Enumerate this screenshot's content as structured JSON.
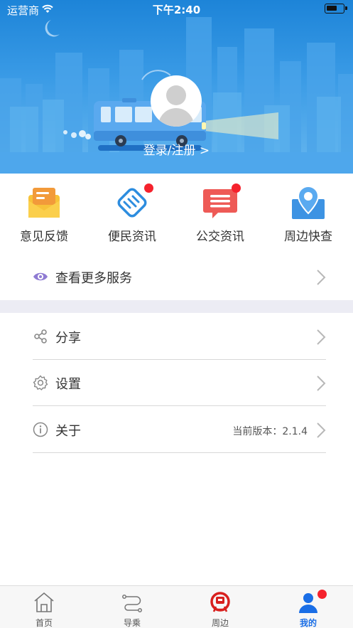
{
  "status_bar": {
    "carrier": "运营商",
    "time": "下午2:40"
  },
  "profile": {
    "login_text": "登录/注册 >"
  },
  "quick_services": [
    {
      "label": "意见反馈",
      "icon": "feedback-envelope-icon",
      "badge": false
    },
    {
      "label": "便民资讯",
      "icon": "handshake-icon",
      "badge": true
    },
    {
      "label": "公交资讯",
      "icon": "message-bubble-icon",
      "badge": true
    },
    {
      "label": "周边快查",
      "icon": "map-pin-icon",
      "badge": false
    }
  ],
  "more_services": {
    "label": "查看更多服务",
    "icon": "eye-icon"
  },
  "menu": [
    {
      "label": "分享",
      "icon": "share-icon",
      "value": ""
    },
    {
      "label": "设置",
      "icon": "gear-icon",
      "value": ""
    },
    {
      "label": "关于",
      "icon": "info-icon",
      "value": "当前版本：2.1.4"
    }
  ],
  "tab_bar": [
    {
      "label": "首页",
      "icon": "home-icon",
      "active": false
    },
    {
      "label": "导乘",
      "icon": "route-icon",
      "active": false
    },
    {
      "label": "周边",
      "icon": "railway-icon",
      "active": false
    },
    {
      "label": "我的",
      "icon": "user-icon",
      "active": true,
      "badge": true
    }
  ],
  "colors": {
    "accent": "#1a6ee6",
    "header_blue": "#3a9be6",
    "badge_red": "#f5222d",
    "feedback_yellow": "#f7c239",
    "bus_news_red": "#ee5a56",
    "map_blue": "#3d93e3"
  }
}
